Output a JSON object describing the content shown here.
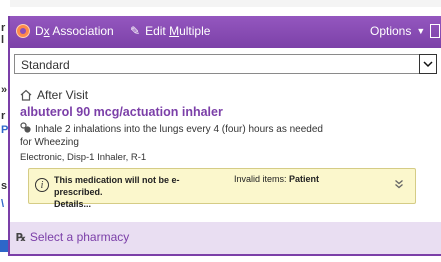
{
  "toolbar": {
    "dx_association": "Dx Association",
    "dx_underline_char": "x",
    "edit_multiple_prefix": "Edit ",
    "edit_multiple_underline": "M",
    "edit_multiple_rest": "ultiple",
    "options": "Options"
  },
  "select": {
    "value": "Standard"
  },
  "section": {
    "title": "After Visit"
  },
  "medication": {
    "name": "albuterol 90 mcg/actuation inhaler",
    "sig": "Inhale 2 inhalations into the lungs every 4 (four) hours as needed",
    "indication": "for Wheezing",
    "dispense": "Electronic, Disp-1 Inhaler, R-1"
  },
  "warning": {
    "message": "This medication will not be e-prescribed.",
    "details": "Details...",
    "invalid_label": "Invalid items:",
    "invalid_value": "Patient"
  },
  "footer": {
    "pharmacy_link": "Select a pharmacy"
  },
  "background": {
    "letters": [
      "r",
      "l",
      "»",
      "r",
      "P",
      "s",
      "\\"
    ]
  },
  "colors": {
    "accent": "#8d4fb8",
    "link": "#7b3fa8",
    "warning_bg": "#fbf7cc",
    "footer_bg": "#e9def2"
  }
}
